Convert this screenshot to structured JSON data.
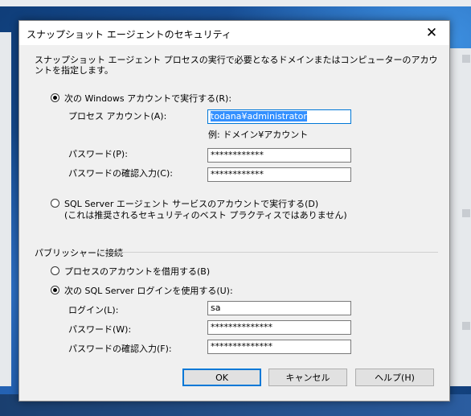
{
  "dialog": {
    "title": "スナップショット エージェントのセキュリティ",
    "close_glyph": "✕",
    "description": "スナップショット エージェント プロセスの実行で必要となるドメインまたはコンピューターのアカウントを指定します。"
  },
  "process_account": {
    "windows_option_label": "次の Windows アカウントで実行する(R):",
    "windows_option_selected": true,
    "account_label": "プロセス アカウント(A):",
    "account_value": "todana¥administrator",
    "account_example": "例: ドメイン¥アカウント",
    "password_label": "パスワード(P):",
    "password_value": "************",
    "confirm_label": "パスワードの確認入力(C):",
    "confirm_value": "************",
    "sqlagent_option_line1": "SQL Server エージェント サービスのアカウントで実行する(D)",
    "sqlagent_option_line2": "(これは推奨されるセキュリティのベスト プラクティスではありません)",
    "sqlagent_option_selected": false
  },
  "publisher": {
    "group_label": "パブリッシャーに接続",
    "impersonate_label": "プロセスのアカウントを借用する(B)",
    "impersonate_selected": false,
    "sql_login_label": "次の SQL Server ログインを使用する(U):",
    "sql_login_selected": true,
    "login_label": "ログイン(L):",
    "login_value": "sa",
    "password_label": "パスワード(W):",
    "password_value": "**************",
    "confirm_label": "パスワードの確認入力(F):",
    "confirm_value": "**************"
  },
  "buttons": {
    "ok": "OK",
    "cancel": "キャンセル",
    "help": "ヘルプ(H)"
  }
}
